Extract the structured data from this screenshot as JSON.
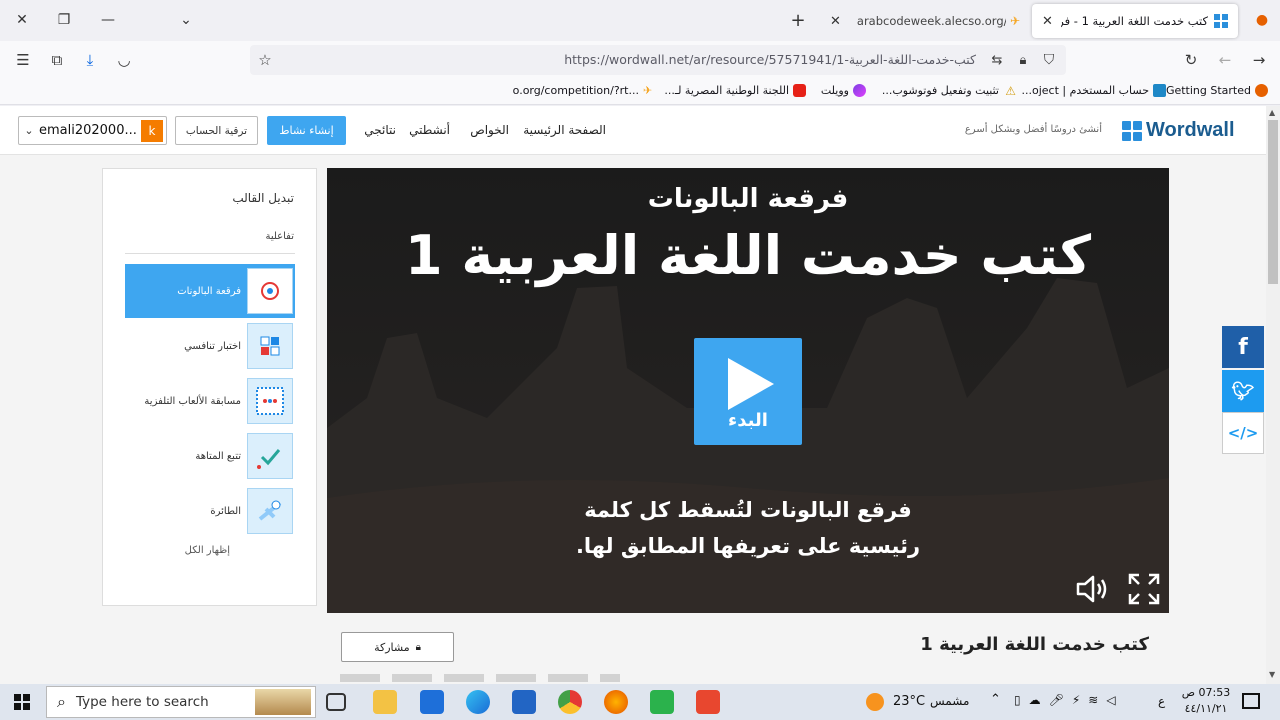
{
  "browser": {
    "tabs": [
      {
        "title": "كتب خدمت اللغة العربية 1 - فرقعة",
        "close": "✕"
      },
      {
        "title": "arabcodeweek.alecso.org/com",
        "close": "✕"
      }
    ],
    "new_tab": "+",
    "url": "https://wordwall.net/ar/resource/57571941/1-كتب-خدمت-اللغة-العربية",
    "bookmarks": [
      "Getting Started",
      "حساب المستخدم | oject...",
      "تثبيت وتفعيل فوتوشوب...",
      "وويلت",
      "اللجنة الوطنية المصرية لـ...",
      "o.org/competition/?rt..."
    ]
  },
  "site": {
    "logo": "Wordwall",
    "tagline": "أنشئ دروسًا أفضل وبشكل أسرع",
    "menu": [
      "الصفحة الرئيسية",
      "الخواص",
      "أنشطتي",
      "نتائجي"
    ],
    "create_button": "إنشاء نشاط",
    "upgrade_button": "ترقية الحساب",
    "user_initial": "k",
    "user_name": "emali202000..."
  },
  "sidebar": {
    "title": "تبديل القالب",
    "section": "تفاعلية",
    "templates": [
      {
        "label": "فرقعة البالونات",
        "selected": true
      },
      {
        "label": "اختبار تنافسي",
        "selected": false
      },
      {
        "label": "مسابقة الألعاب التلفزية",
        "selected": false
      },
      {
        "label": "تتبع المتاهة",
        "selected": false
      },
      {
        "label": "الطائرة",
        "selected": false
      }
    ],
    "show_all": "إظهار الكل"
  },
  "player": {
    "subtitle": "فرقعة البالونات",
    "title": "كتب خدمت اللغة العربية 1",
    "start": "البدء",
    "instructions_line1": "فرقع البالونات لتُسقط كل كلمة",
    "instructions_line2": "رئيسية على تعريفها المطابق لها."
  },
  "activity": {
    "title": "كتب خدمت اللغة العربية 1",
    "share_button": "مشاركة"
  },
  "taskbar": {
    "search_placeholder": "Type here to search",
    "weather_temp": "23°C",
    "weather_text": "مشمس",
    "time": "07:53 ص",
    "date": "٤٤/١١/٢١",
    "lang": "ع"
  },
  "colors": {
    "accent": "#3ea6f0",
    "facebook": "#1f5fa8",
    "twitter": "#1d9bf0",
    "user_badge": "#f57c00"
  }
}
